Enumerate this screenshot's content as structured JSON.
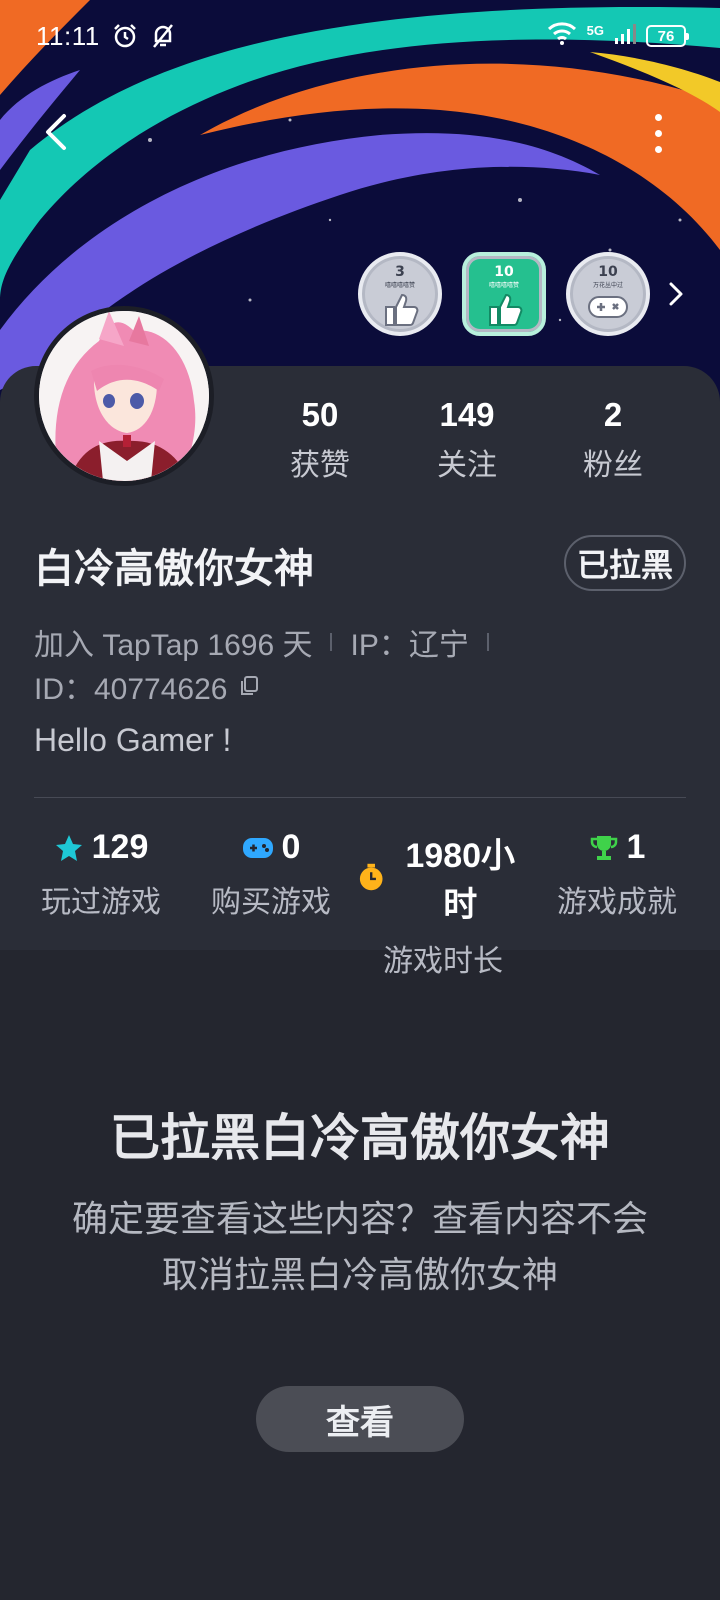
{
  "status_bar": {
    "time": "11:11",
    "network": "5G",
    "battery": "76"
  },
  "badges": [
    {
      "number": "3",
      "caption": "嘻嘻嘻嘻赞",
      "icon": "thumbs-up-icon"
    },
    {
      "number": "10",
      "caption": "嘻嘻嘻嘻赞",
      "icon": "thumbs-up-icon"
    },
    {
      "number": "10",
      "caption": "万花丛中过",
      "icon": "gamepad-icon"
    }
  ],
  "profile": {
    "stats": [
      {
        "value": "50",
        "label": "获赞"
      },
      {
        "value": "149",
        "label": "关注"
      },
      {
        "value": "2",
        "label": "粉丝"
      }
    ],
    "name": "白冷高傲你女神",
    "blocked_label": "已拉黑",
    "joined": "加入 TapTap 1696 天",
    "ip": "IP：辽宁",
    "id": "ID：40774626",
    "bio": "Hello Gamer !"
  },
  "game_stats": [
    {
      "value": "129",
      "label": "玩过游戏",
      "icon": "star-icon",
      "color": "#1ec8d6"
    },
    {
      "value": "0",
      "label": "购买游戏",
      "icon": "gamepad-icon",
      "color": "#2fa8ff"
    },
    {
      "value": "1980小时",
      "label": "游戏时长",
      "icon": "stopwatch-icon",
      "color": "#ffb31a"
    },
    {
      "value": "1",
      "label": "游戏成就",
      "icon": "trophy-icon",
      "color": "#3fd24a"
    }
  ],
  "blocked_notice": {
    "title": "已拉黑白冷高傲你女神",
    "description": "确定要查看这些内容？查看内容不会取消拉黑白冷高傲你女神",
    "button": "查看"
  },
  "colors": {
    "background": "#24262f",
    "card": "#2a2d37",
    "banner_navy": "#0b0c3a",
    "teal_swoosh": "#14c8b4",
    "orange_swoosh": "#f06a24",
    "purple_swoosh": "#6a5ae0"
  }
}
